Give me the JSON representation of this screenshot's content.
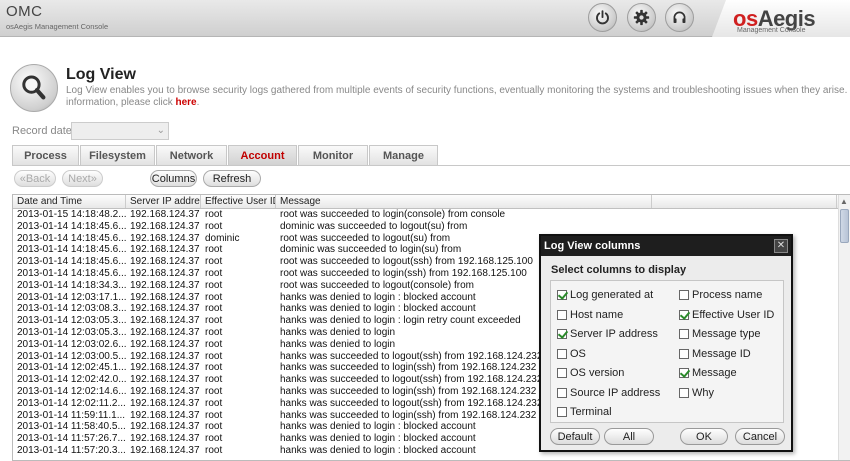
{
  "header": {
    "app_name": "OMC",
    "app_subtitle": "osAegis Management Console",
    "brand_os": "os",
    "brand_aegis": "Aegis",
    "brand_subtitle": "Management Console"
  },
  "page": {
    "title": "Log View",
    "description_line1": "Log View enables you to browse security logs gathered from multiple events of security functions, eventually monitoring the systems and troubleshooting issues when they arise. If you need more",
    "description_line2_prefix": "information, please click ",
    "description_link": "here",
    "description_line2_suffix": "."
  },
  "record_date": {
    "label": "Record date",
    "value": ""
  },
  "tabs": [
    {
      "label": "Process",
      "active": false
    },
    {
      "label": "Filesystem",
      "active": false
    },
    {
      "label": "Network",
      "active": false
    },
    {
      "label": "Account",
      "active": true
    },
    {
      "label": "Monitor",
      "active": false
    },
    {
      "label": "Manage",
      "active": false
    }
  ],
  "toolbar": {
    "back_label": "«Back",
    "next_label": "Next»",
    "columns_label": "Columns",
    "refresh_label": "Refresh"
  },
  "table": {
    "columns": [
      "Date and Time",
      "Server IP address",
      "Effective User ID",
      "Message",
      ""
    ],
    "rows": [
      [
        "2013-01-15 14:18:48.2...",
        "192.168.124.37",
        "root",
        "root was succeeded to login(console) from console"
      ],
      [
        "2013-01-14 14:18:45.6...",
        "192.168.124.37",
        "root",
        "dominic was succeeded to logout(su) from"
      ],
      [
        "2013-01-14 14:18:45.6...",
        "192.168.124.37",
        "dominic",
        "root was succeeded to logout(su) from"
      ],
      [
        "2013-01-14 14:18:45.6...",
        "192.168.124.37",
        "root",
        "dominic was succeeded to login(su) from"
      ],
      [
        "2013-01-14 14:18:45.6...",
        "192.168.124.37",
        "root",
        "root was succeeded to logout(ssh) from 192.168.125.100"
      ],
      [
        "2013-01-14 14:18:45.6...",
        "192.168.124.37",
        "root",
        "root was succeeded to login(ssh) from 192.168.125.100"
      ],
      [
        "2013-01-14 14:18:34.3...",
        "192.168.124.37",
        "root",
        "root was succeeded to logout(console) from"
      ],
      [
        "2013-01-14 12:03:17.1...",
        "192.168.124.37",
        "root",
        "hanks was denied to login : blocked account"
      ],
      [
        "2013-01-14 12:03:08.3...",
        "192.168.124.37",
        "root",
        "hanks was denied to login : blocked account"
      ],
      [
        "2013-01-14 12:03:05.3...",
        "192.168.124.37",
        "root",
        "hanks was denied to login : login retry count exceeded"
      ],
      [
        "2013-01-14 12:03:05.3...",
        "192.168.124.37",
        "root",
        "hanks was denied to login"
      ],
      [
        "2013-01-14 12:03:02.6...",
        "192.168.124.37",
        "root",
        "hanks was denied to login"
      ],
      [
        "2013-01-14 12:03:00.5...",
        "192.168.124.37",
        "root",
        "hanks was succeeded to logout(ssh) from 192.168.124.232"
      ],
      [
        "2013-01-14 12:02:45.1...",
        "192.168.124.37",
        "root",
        "hanks was succeeded to login(ssh) from 192.168.124.232"
      ],
      [
        "2013-01-14 12:02:42.0...",
        "192.168.124.37",
        "root",
        "hanks was succeeded to logout(ssh) from 192.168.124.232"
      ],
      [
        "2013-01-14 12:02:14.6...",
        "192.168.124.37",
        "root",
        "hanks was succeeded to login(ssh) from 192.168.124.232"
      ],
      [
        "2013-01-14 12:02:11.2...",
        "192.168.124.37",
        "root",
        "hanks was succeeded to logout(ssh) from 192.168.124.232"
      ],
      [
        "2013-01-14 11:59:11.1...",
        "192.168.124.37",
        "root",
        "hanks was succeeded to login(ssh) from 192.168.124.232"
      ],
      [
        "2013-01-14 11:58:40.5...",
        "192.168.124.37",
        "root",
        "hanks was denied to login : blocked account"
      ],
      [
        "2013-01-14 11:57:26.7...",
        "192.168.124.37",
        "root",
        "hanks was denied to login : blocked account"
      ],
      [
        "2013-01-14 11:57:20.3...",
        "192.168.124.37",
        "root",
        "hanks was denied to login : blocked account"
      ]
    ]
  },
  "dialog": {
    "title": "Log View columns",
    "subtitle": "Select columns to display",
    "options_left": [
      {
        "label": "Log generated at",
        "checked": true
      },
      {
        "label": "Host name",
        "checked": false
      },
      {
        "label": "Server IP address",
        "checked": true
      },
      {
        "label": "OS",
        "checked": false
      },
      {
        "label": "OS version",
        "checked": false
      },
      {
        "label": "Source IP address",
        "checked": false
      },
      {
        "label": "Terminal",
        "checked": false
      }
    ],
    "options_right": [
      {
        "label": "Process name",
        "checked": false
      },
      {
        "label": "Effective User ID",
        "checked": true
      },
      {
        "label": "Message type",
        "checked": false
      },
      {
        "label": "Message ID",
        "checked": false
      },
      {
        "label": "Message",
        "checked": true
      },
      {
        "label": "Why",
        "checked": false
      }
    ],
    "buttons": {
      "default": "Default",
      "all": "All",
      "ok": "OK",
      "cancel": "Cancel"
    }
  },
  "icons": [
    "power-icon",
    "gear-icon",
    "headset-icon",
    "magnifier-icon",
    "chevron-down-icon",
    "close-icon",
    "scroll-up-icon"
  ]
}
